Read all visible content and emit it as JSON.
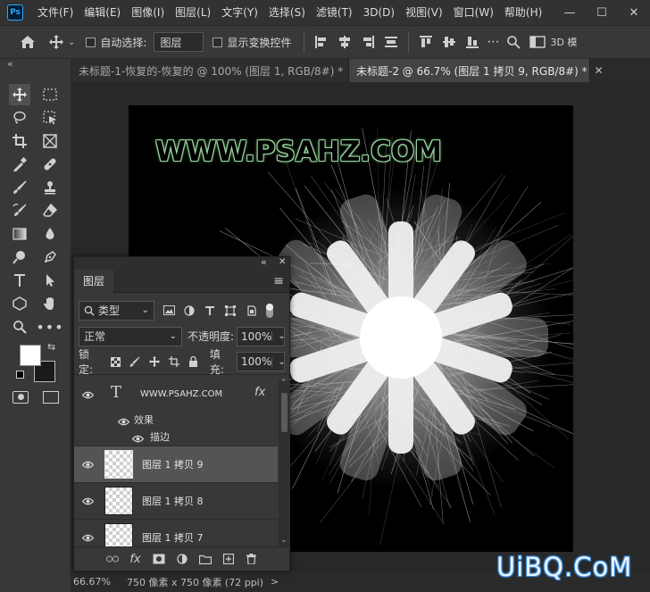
{
  "app": {
    "logo_text": "Ps",
    "menu": [
      "文件(F)",
      "编辑(E)",
      "图像(I)",
      "图层(L)",
      "文字(Y)",
      "选择(S)",
      "滤镜(T)",
      "3D(D)",
      "视图(V)",
      "窗口(W)",
      "帮助(H)"
    ],
    "window_buttons": [
      "—",
      "☐",
      "✕"
    ]
  },
  "options_bar": {
    "auto_select_label": "自动选择:",
    "auto_select_value": "图层",
    "show_transform_label": "显示变换控件",
    "mode_3d_label": "3D 模"
  },
  "tabs": [
    {
      "label": "未标题-1-恢复的-恢复的 @ 100% (图层 1, RGB/8#) *",
      "close": "✕",
      "active": false
    },
    {
      "label": "未标题-2 @ 66.7% (图层 1 拷贝 9, RGB/8#) *",
      "close": "✕",
      "active": true
    }
  ],
  "canvas": {
    "text": "WWW.PSAHZ.COM"
  },
  "status": {
    "zoom": "66.67%",
    "doc_size": "750 像素 x 750 像素 (72 ppi)",
    "arrow": ">"
  },
  "watermark": "UiBQ.CoM",
  "layers_panel": {
    "collapse_btn": "«",
    "close_btn": "✕",
    "tab_label": "图层",
    "menu_icon": "≡",
    "filter_kind": "类型",
    "blend_mode": "正常",
    "opacity_label": "不透明度:",
    "opacity_value": "100%",
    "lock_label": "锁定:",
    "fill_label": "填充:",
    "fill_value": "100%",
    "text_layer": {
      "name": "WWW.PSAHZ.COM",
      "fx": "fx",
      "effects_label": "效果",
      "stroke_label": "描边"
    },
    "layers": [
      {
        "name": "图层 1 拷贝 9",
        "selected": true
      },
      {
        "name": "图层 1 拷贝 8",
        "selected": false
      },
      {
        "name": "图层 1 拷贝 7",
        "selected": false
      }
    ]
  }
}
